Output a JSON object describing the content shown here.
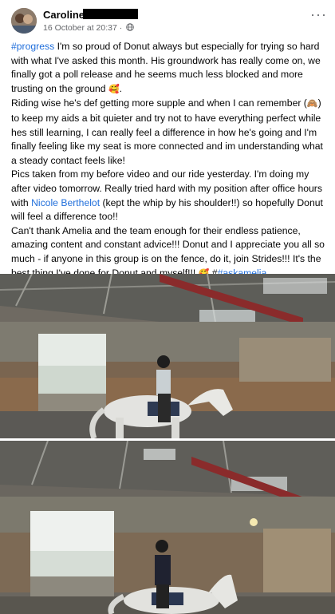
{
  "post": {
    "author": "Caroline",
    "timestamp": "16 October at 20:37",
    "dot": "·",
    "more_icon": "···",
    "text": {
      "p1_tag": "#progress",
      "p1": " I'm so proud of Donut always but especially for trying so hard with what I've asked this month.   His groundwork has really come on, we finally got a poll release and he seems much less blocked and more trusting on the ground ",
      "p1_emoji": "🥰",
      "p1_end": ".",
      "p2": "Riding wise he's def getting more supple and when I can remember (",
      "p2_emoji": "🙈",
      "p2b": ") to keep my aids a bit quieter and try not to have everything perfect while hes still learning, I can really feel a difference in how he's going and I'm finally feeling like my seat is more connected and im understanding what a steady contact feels like!",
      "p3a": "Pics taken from my before video and our ride yesterday.  I'm doing my after video tomorrow. Really tried hard with my position after office hours with ",
      "p3_mention": "Nicole Berthelot",
      "p3b": " (kept the whip by his shoulder!!) so hopefully Donut will feel a difference too!!",
      "p4": "Can't thank Amelia and the team enough for their endless patience, amazing content and constant advice!!! Donut and I appreciate you all so much - if anyone in this group is on the fence, do it, join Strides!!! It's the best thing I've done for Donut and myself!!! ",
      "p4_emoji": "🥰",
      "p4_hash": " #",
      "p4_tag": "#askamelia"
    }
  },
  "colors": {
    "link": "#216fdb",
    "meta": "#65676b",
    "text": "#050505"
  },
  "icons": [
    "avatar",
    "globe-icon",
    "more-options-icon"
  ]
}
